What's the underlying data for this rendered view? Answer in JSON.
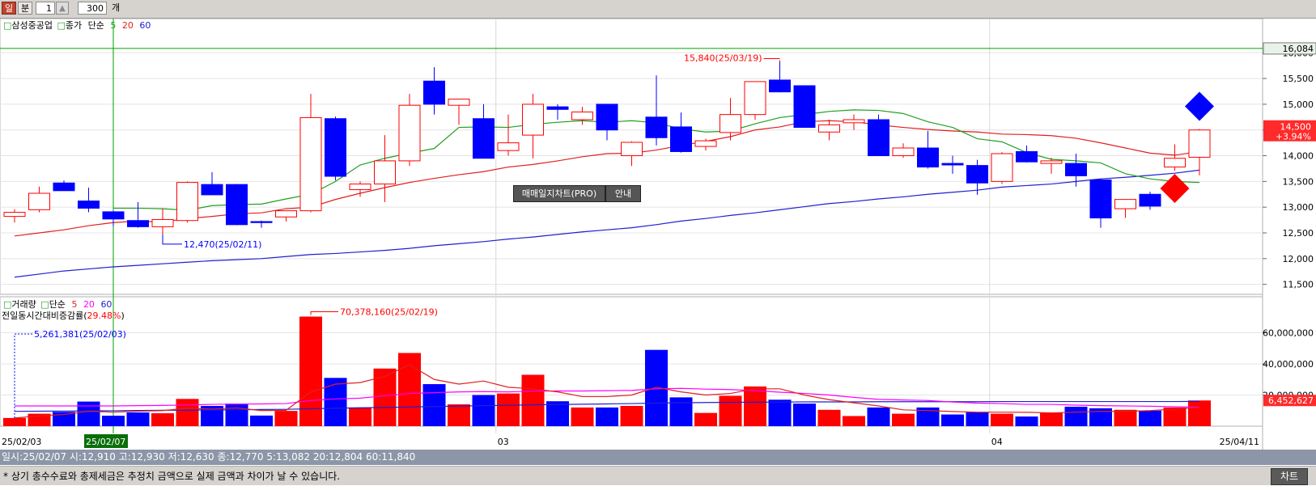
{
  "toolbar": {
    "day_label": "일",
    "minute_label": "분",
    "minute_value": "1",
    "count_value": "300",
    "count_unit": "개"
  },
  "price_panel": {
    "stock_name": "삼성중공업",
    "price_label": "종가",
    "ma_type": "단순",
    "ma_labels": [
      "5",
      "20",
      "60"
    ],
    "high_marker": "15,840(25/03/19)",
    "low_marker": "12,470(25/02/11)",
    "top_line_label": "16,084",
    "current_price": "14,500",
    "change_pct": "+3.94%",
    "y_ticks": [
      "16,000",
      "15,500",
      "15,000",
      "14,500",
      "14,000",
      "13,500",
      "13,000",
      "12,500",
      "12,000",
      "11,500"
    ]
  },
  "volume_panel": {
    "title": "거래량",
    "ma_type": "단순",
    "ma_labels": [
      "5",
      "20",
      "60"
    ],
    "ratio_label": "전일동시간대비증감률(",
    "ratio_value": "29.48%",
    "ratio_close": ")",
    "max_marker": "70,378,160(25/02/19)",
    "min_marker": "5,261,381(25/02/03)",
    "current_volume": "6,452,627",
    "y_ticks": [
      "60,000,000",
      "40,000,000",
      "20,000,000"
    ]
  },
  "x_axis": {
    "start_label": "25/02/03",
    "cursor_label": "25/02/07",
    "month_labels": [
      "03",
      "04"
    ],
    "end_label": "25/04/11"
  },
  "overlay_buttons": {
    "pro_label": "매매일지차트(PRO)",
    "guide_label": "안내"
  },
  "status_line": "일시:25/02/07 시:12,910 고:12,930 저:12,630 종:12,770 5:13,082 20:12,804 60:11,840",
  "footer": {
    "notice": "* 상기 총수수료와 총제세금은 추정치 금액으로 실제 금액과 차이가 날 수 있습니다.",
    "chart_button": "차트"
  },
  "colors": {
    "up": "#ff0000",
    "down": "#0000ff",
    "ma5": "#20a020",
    "ma20": "#e02020",
    "ma60": "#2020d0",
    "vol_ma20": "#ff00ff",
    "cursor": "#00a000"
  },
  "chart_data": {
    "type": "candlestick",
    "dates": [
      "25/02/03",
      "25/02/04",
      "25/02/05",
      "25/02/06",
      "25/02/07",
      "25/02/10",
      "25/02/11",
      "25/02/12",
      "25/02/13",
      "25/02/14",
      "25/02/17",
      "25/02/18",
      "25/02/19",
      "25/02/20",
      "25/02/21",
      "25/02/24",
      "25/02/25",
      "25/02/26",
      "25/02/27",
      "25/02/28",
      "25/03/04",
      "25/03/05",
      "25/03/06",
      "25/03/07",
      "25/03/10",
      "25/03/11",
      "25/03/12",
      "25/03/13",
      "25/03/14",
      "25/03/17",
      "25/03/18",
      "25/03/19",
      "25/03/20",
      "25/03/21",
      "25/03/24",
      "25/03/25",
      "25/03/26",
      "25/03/27",
      "25/03/28",
      "25/03/31",
      "25/04/01",
      "25/04/02",
      "25/04/03",
      "25/04/04",
      "25/04/07",
      "25/04/08",
      "25/04/09",
      "25/04/10",
      "25/04/11"
    ],
    "ohlc": [
      [
        12820,
        12960,
        12700,
        12900
      ],
      [
        12950,
        13400,
        12900,
        13270
      ],
      [
        13470,
        13520,
        13400,
        13320
      ],
      [
        13120,
        13380,
        12900,
        12980
      ],
      [
        12910,
        12930,
        12630,
        12770
      ],
      [
        12740,
        13100,
        12600,
        12620
      ],
      [
        12620,
        12980,
        12470,
        12760
      ],
      [
        12740,
        13500,
        12700,
        13480
      ],
      [
        13440,
        13680,
        13360,
        13240
      ],
      [
        13440,
        13450,
        12650,
        12660
      ],
      [
        12720,
        12740,
        12600,
        12700
      ],
      [
        12810,
        12940,
        12720,
        12930
      ],
      [
        12930,
        15200,
        12900,
        14740
      ],
      [
        14720,
        14760,
        13520,
        13600
      ],
      [
        13340,
        13500,
        13200,
        13450
      ],
      [
        13450,
        14400,
        13100,
        13900
      ],
      [
        13900,
        15200,
        13800,
        14980
      ],
      [
        15450,
        15720,
        14800,
        15000
      ],
      [
        14980,
        15000,
        14600,
        15100
      ],
      [
        14720,
        15000,
        13950,
        13950
      ],
      [
        14100,
        14800,
        14000,
        14250
      ],
      [
        14400,
        15200,
        13950,
        15000
      ],
      [
        14950,
        15000,
        14700,
        14900
      ],
      [
        14700,
        14950,
        14600,
        14850
      ],
      [
        15000,
        15000,
        14300,
        14500
      ],
      [
        14000,
        14280,
        13800,
        14260
      ],
      [
        14750,
        15560,
        14200,
        14350
      ],
      [
        14560,
        14840,
        14060,
        14080
      ],
      [
        14180,
        14330,
        14100,
        14290
      ],
      [
        14450,
        15120,
        14300,
        14800
      ],
      [
        14800,
        15440,
        14700,
        15440
      ],
      [
        15470,
        15840,
        15230,
        15240
      ],
      [
        15360,
        15360,
        14550,
        14550
      ],
      [
        14460,
        14700,
        14300,
        14600
      ],
      [
        14640,
        14800,
        14500,
        14700
      ],
      [
        14700,
        14800,
        14000,
        14000
      ],
      [
        14000,
        14240,
        13960,
        14150
      ],
      [
        14150,
        14480,
        13750,
        13780
      ],
      [
        13850,
        14000,
        13650,
        13820
      ],
      [
        13810,
        13920,
        13240,
        13470
      ],
      [
        13500,
        14070,
        13450,
        14040
      ],
      [
        14080,
        14200,
        13870,
        13880
      ],
      [
        13850,
        13960,
        13650,
        13900
      ],
      [
        13850,
        14040,
        13400,
        13610
      ],
      [
        13530,
        13550,
        12600,
        12790
      ],
      [
        12970,
        13150,
        12790,
        13150
      ],
      [
        13250,
        13300,
        12950,
        13020
      ],
      [
        13780,
        14220,
        13710,
        13950
      ],
      [
        13970,
        14520,
        13620,
        14500
      ]
    ],
    "ma5": [
      null,
      null,
      null,
      null,
      12980,
      12980,
      12970,
      12940,
      13030,
      13050,
      13060,
      13160,
      13250,
      13500,
      13820,
      13950,
      14050,
      14140,
      14550,
      14560,
      14550,
      14610,
      14650,
      14680,
      14650,
      14680,
      14640,
      14520,
      14460,
      14480,
      14620,
      14740,
      14800,
      14860,
      14890,
      14880,
      14820,
      14660,
      14550,
      14330,
      14270,
      14060,
      13930,
      13900,
      13860,
      13650,
      13550,
      13500,
      13480
    ],
    "ma20": [
      12440,
      12500,
      12560,
      12640,
      12700,
      12730,
      12710,
      12780,
      12820,
      12870,
      12890,
      12970,
      13000,
      13150,
      13270,
      13380,
      13480,
      13560,
      13630,
      13690,
      13780,
      13830,
      13900,
      13980,
      14040,
      14050,
      14110,
      14200,
      14280,
      14370,
      14500,
      14560,
      14660,
      14680,
      14660,
      14600,
      14550,
      14510,
      14480,
      14460,
      14420,
      14410,
      14390,
      14340,
      14250,
      14150,
      14050,
      14010,
      14080
    ],
    "ma60": [
      11640,
      11700,
      11760,
      11800,
      11840,
      11870,
      11900,
      11930,
      11960,
      11980,
      12000,
      12040,
      12080,
      12100,
      12130,
      12160,
      12200,
      12250,
      12290,
      12330,
      12380,
      12420,
      12470,
      12520,
      12560,
      12600,
      12660,
      12730,
      12780,
      12840,
      12890,
      12950,
      13010,
      13070,
      13110,
      13160,
      13200,
      13250,
      13290,
      13330,
      13390,
      13420,
      13450,
      13500,
      13550,
      13580,
      13620,
      13660,
      13720
    ],
    "volume": [
      5261381,
      8000000,
      9200000,
      15800000,
      6700000,
      8800000,
      8300000,
      17500000,
      13000000,
      14500000,
      6800000,
      9800000,
      70378160,
      31000000,
      12000000,
      37000000,
      47000000,
      27000000,
      14000000,
      20000000,
      21000000,
      33000000,
      16000000,
      12000000,
      12000000,
      13000000,
      49000000,
      18500000,
      8500000,
      19500000,
      25500000,
      17000000,
      14500000,
      10500000,
      6500000,
      12000000,
      8000000,
      12000000,
      7500000,
      9000000,
      8000000,
      6200000,
      8500000,
      12500000,
      11500000,
      10500000,
      10000000,
      12000000,
      16500000
    ],
    "vol_ma5": [
      5261381,
      6600000,
      7500000,
      9600000,
      9000000,
      9600000,
      10000000,
      11500000,
      11000000,
      11700000,
      10000000,
      10200000,
      22000000,
      27000000,
      28000000,
      32000000,
      39500000,
      30000000,
      27000000,
      29000000,
      25000000,
      24000000,
      22000000,
      19000000,
      19000000,
      20000000,
      25000000,
      22000000,
      20000000,
      21000000,
      24000000,
      24000000,
      20000000,
      17000000,
      15000000,
      13000000,
      10500000,
      10000000,
      9400000,
      9000000,
      9000000,
      8900000,
      8500000,
      9000000,
      9500000,
      9500000,
      10000000,
      11000000,
      12000000
    ],
    "vol_ma20": [
      13000000,
      13000000,
      13000000,
      13000000,
      13000000,
      13200000,
      13300000,
      13600000,
      14000000,
      14200000,
      14300000,
      14500000,
      16500000,
      17500000,
      18000000,
      19500000,
      21000000,
      21500000,
      22000000,
      22200000,
      22000000,
      22500000,
      22600000,
      22600000,
      22800000,
      23000000,
      24000000,
      24300000,
      23800000,
      23500000,
      22800000,
      21800000,
      21000000,
      20000000,
      18500000,
      17200000,
      16800000,
      16500000,
      15500000,
      14800000,
      14500000,
      14000000,
      14000000,
      13500000,
      13200000,
      13000000,
      12800000,
      12500000,
      12200000
    ],
    "vol_ma60": [
      9500000,
      9600000,
      9700000,
      9800000,
      9900000,
      10100000,
      10200000,
      10300000,
      10400000,
      10500000,
      10700000,
      10800000,
      11200000,
      11500000,
      11800000,
      12000000,
      12300000,
      12600000,
      12900000,
      13200000,
      13400000,
      13700000,
      13900000,
      14100000,
      14300000,
      14500000,
      14800000,
      15000000,
      15200000,
      15300000,
      15400000,
      15500000,
      15600000,
      15600000,
      15600000,
      15700000,
      15700000,
      15700000,
      15700000,
      15700000,
      15800000,
      15800000,
      15800000,
      15800000,
      15800000,
      15800000,
      15800000,
      15800000,
      15900000
    ],
    "price_ylim": [
      11400,
      16350
    ],
    "volume_ylim": [
      0,
      80000000
    ],
    "signals": [
      {
        "type": "sell",
        "index": 48
      },
      {
        "type": "buy",
        "index": 47
      }
    ]
  }
}
